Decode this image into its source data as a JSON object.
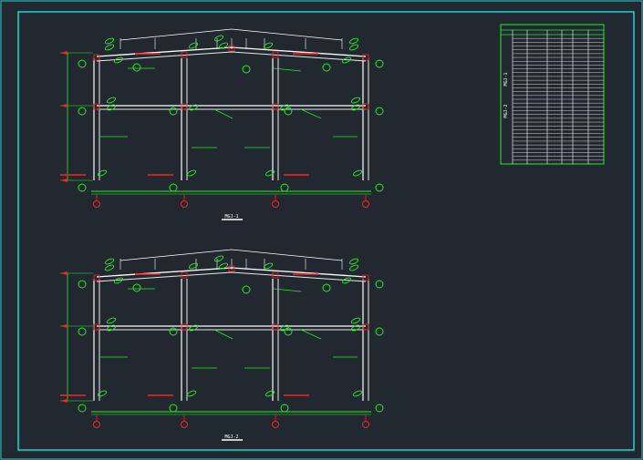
{
  "colors": {
    "background": "#212830",
    "border": "#17d6d6",
    "frame": "#ffffff",
    "member": "#e8e8e8",
    "annotation": "#22ee22",
    "section_mark": "#ff2020",
    "axis_bubble": "#ff2020"
  },
  "drawings": [
    {
      "label": "MGJ-1"
    },
    {
      "label": "MGJ-2"
    }
  ],
  "schedule_table": {
    "row_labels": [
      "MGJ-1",
      "MGJ-2"
    ],
    "row_count": 34
  }
}
